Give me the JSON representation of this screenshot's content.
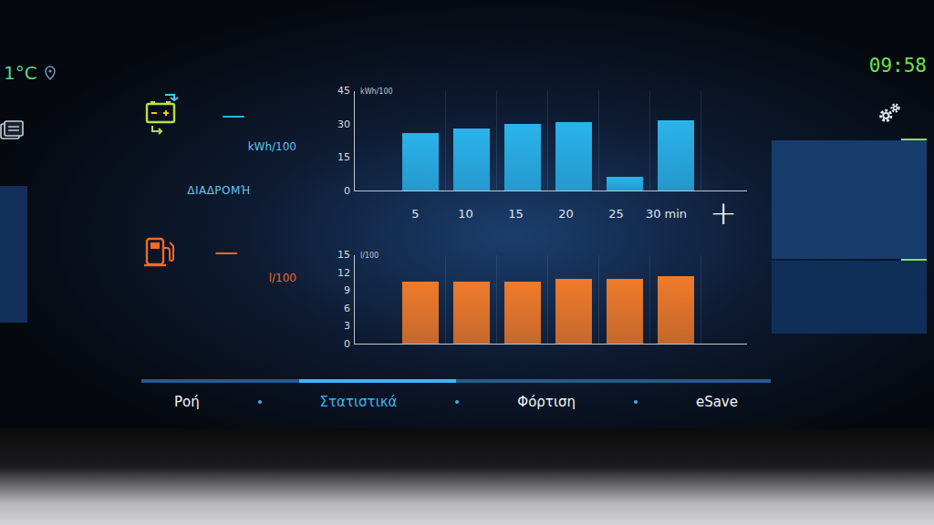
{
  "status": {
    "temperature": "1°C",
    "time": "09:58"
  },
  "electric": {
    "value": "—",
    "unit": "kWh/100"
  },
  "section_label": "ΔΙΑΔΡΟΜΉ",
  "fuel": {
    "value": "—",
    "unit": "l/100"
  },
  "charts": [
    {
      "name": "electric",
      "axis_label": "kWh/100",
      "ticks": [
        "45",
        "30",
        "15",
        "0"
      ],
      "values": [
        26,
        28,
        30,
        31,
        6,
        32
      ],
      "color": "#2ab4ec"
    },
    {
      "name": "fuel",
      "axis_label": "l/100",
      "ticks": [
        "15",
        "12",
        "9",
        "6",
        "3",
        "0"
      ],
      "values": [
        10.5,
        10.5,
        10.5,
        11,
        11,
        11.5
      ],
      "color": "#f07a2a"
    }
  ],
  "x_labels": [
    "5",
    "10",
    "15",
    "20",
    "25",
    "30 min"
  ],
  "add_button": "+",
  "tabs": [
    {
      "label": "Ροή",
      "selected": false
    },
    {
      "label": "Στατιστικά",
      "selected": true
    },
    {
      "label": "Φόρτιση",
      "selected": false
    },
    {
      "label": "eSave",
      "selected": false
    }
  ]
}
